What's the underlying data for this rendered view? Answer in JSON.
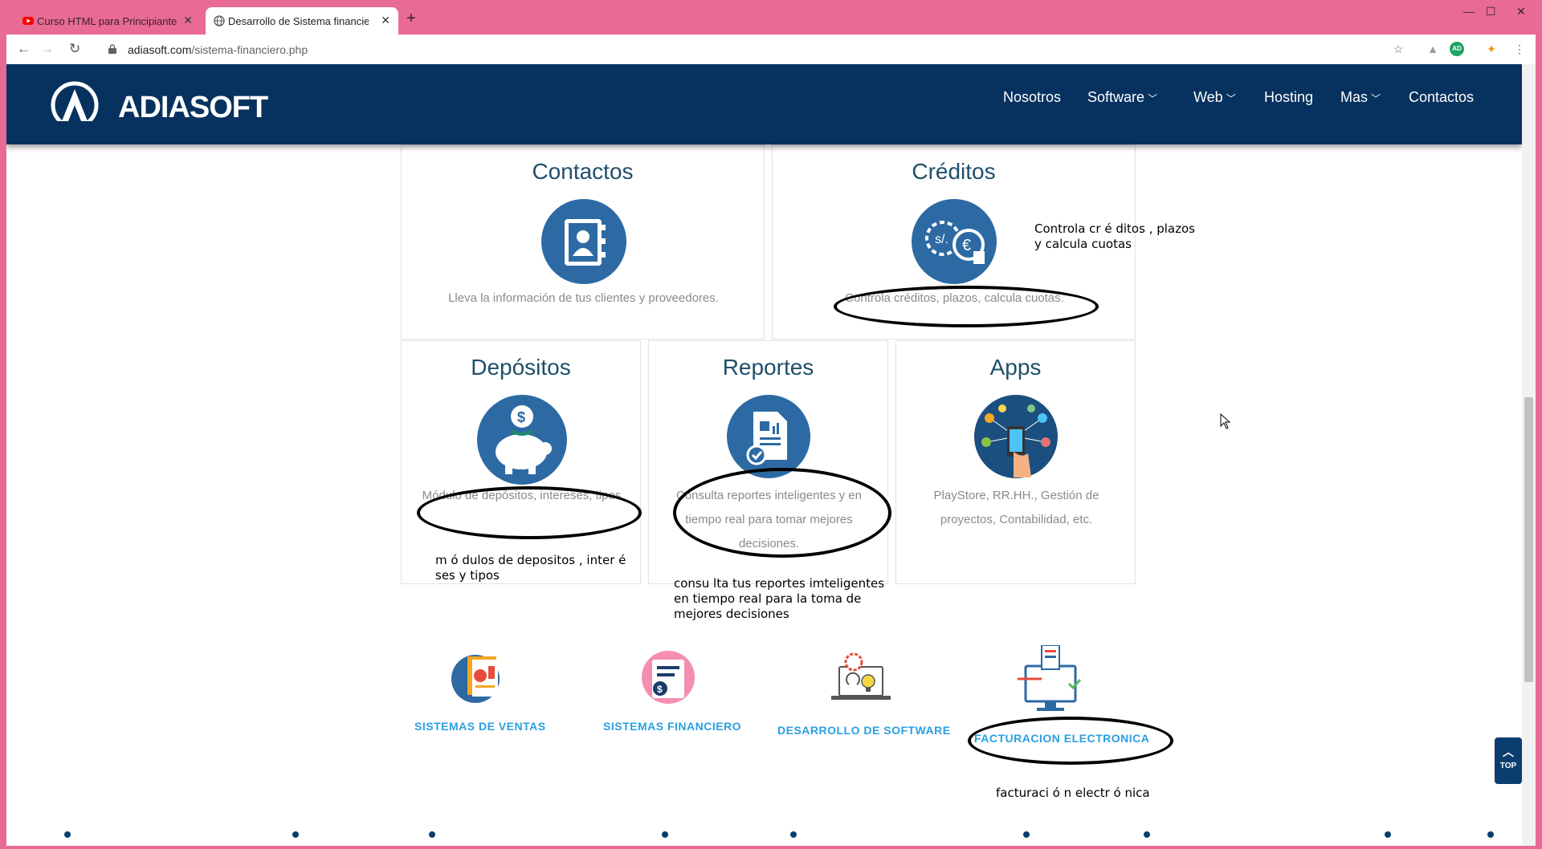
{
  "browser": {
    "tabs": [
      {
        "title": "Curso HTML para Principiantes -",
        "active": false,
        "favicon": "youtube-icon"
      },
      {
        "title": "Desarrollo de Sistema financiero",
        "active": true,
        "favicon": "globe-icon"
      }
    ],
    "url_domain": "adiasoft.com",
    "url_path": "/sistema-financiero.php",
    "minimize": "—",
    "maximize": "☐",
    "close": "✕"
  },
  "site": {
    "logo_text": "ADIASOFT",
    "nav": [
      {
        "label": "Nosotros",
        "dropdown": false
      },
      {
        "label": "Software",
        "dropdown": true
      },
      {
        "label": "Web",
        "dropdown": true
      },
      {
        "label": "Hosting",
        "dropdown": false
      },
      {
        "label": "Mas",
        "dropdown": true
      },
      {
        "label": "Contactos",
        "dropdown": false
      }
    ]
  },
  "cards": {
    "contactos": {
      "title": "Contactos",
      "desc": "Lleva la información de tus clientes y proveedores."
    },
    "creditos": {
      "title": "Créditos",
      "desc": "Controla créditos, plazos, calcula cuotas."
    },
    "depositos": {
      "title": "Depósitos",
      "desc": "Módulo de depósitos, intereses, tipos"
    },
    "reportes": {
      "title": "Reportes",
      "desc": "Consulta reportes inteligentes y en tiempo real para tomar mejores decisiones."
    },
    "apps": {
      "title": "Apps",
      "desc": "PlayStore, RR.HH., Gestión de proyectos, Contabilidad, etc."
    }
  },
  "notes": {
    "creditos": "Controla cr é ditos , plazos y calcula cuotas",
    "depositos": "m ó dulos de depositos , inter é ses y tipos",
    "reportes": "consu lta tus reportes imteligentes en tiempo real para la toma de mejores decisiones",
    "facturacion": "facturaci ó n electr ó nica"
  },
  "systems": [
    {
      "label": "SISTEMAS DE VENTAS"
    },
    {
      "label": "SISTEMAS FINANCIERO"
    },
    {
      "label": "DESARROLLO DE SOFTWARE"
    },
    {
      "label": "FACTURACION ELECTRONICA"
    }
  ],
  "top_button": "TOP",
  "colors": {
    "header": "#07325f",
    "accent": "#2b9fe0",
    "icon_circle": "#2d6aa3",
    "title": "#1f4f6a"
  }
}
